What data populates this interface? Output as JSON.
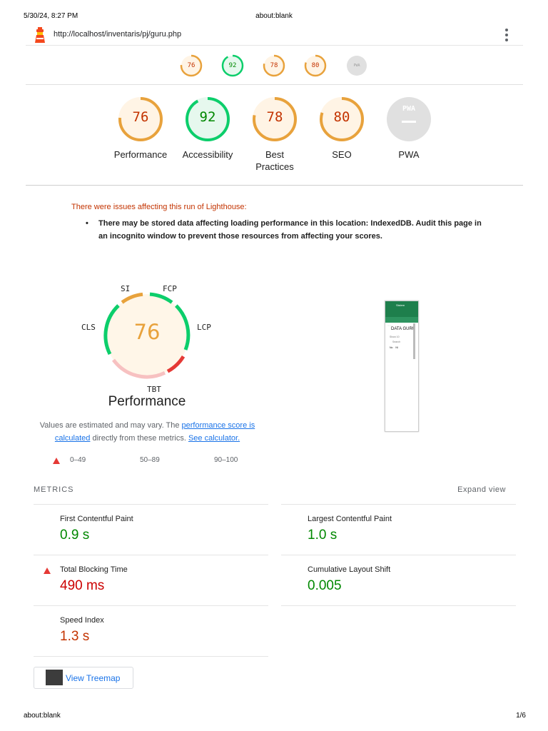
{
  "print_header": {
    "date": "5/30/24, 8:27 PM",
    "title": "about:blank"
  },
  "print_footer": {
    "left": "about:blank",
    "right": "1/6"
  },
  "topbar": {
    "url": "http://localhost/inventaris/pj/guru.php",
    "logo_icon": "lighthouse-icon",
    "menu_icon": "kebab-menu-icon"
  },
  "mini_scores": [
    {
      "label": "76",
      "color": "#e8a23c",
      "fraction": 0.76
    },
    {
      "label": "92",
      "color": "#0cce6b",
      "fraction": 0.92
    },
    {
      "label": "78",
      "color": "#e8a23c",
      "fraction": 0.78
    },
    {
      "label": "80",
      "color": "#e8a23c",
      "fraction": 0.8
    },
    {
      "label": "PWA",
      "color": "#9e9e9e",
      "fraction": 0
    }
  ],
  "categories": [
    {
      "score": "76",
      "label": "Performance",
      "color": "#e8a23c",
      "text_color": "#c33300",
      "bg": "#fff4e5",
      "fraction": 0.76
    },
    {
      "score": "92",
      "label": "Accessibility",
      "color": "#0cce6b",
      "text_color": "#008800",
      "bg": "#e6f8ee",
      "fraction": 0.92
    },
    {
      "score": "78",
      "label": "Best Practices",
      "color": "#e8a23c",
      "text_color": "#c33300",
      "bg": "#fff4e5",
      "fraction": 0.78
    },
    {
      "score": "80",
      "label": "SEO",
      "color": "#e8a23c",
      "text_color": "#c33300",
      "bg": "#fff4e5",
      "fraction": 0.8
    },
    {
      "score": "PWA",
      "label": "PWA",
      "color": "#9e9e9e",
      "text_color": "#ffffff",
      "bg": "#e0e0e0",
      "fraction": 0
    }
  ],
  "warnings": {
    "title": "There were issues affecting this run of Lighthouse:",
    "items": [
      "There may be stored data affecting loading performance in this location: IndexedDB. Audit this page in an incognito window to prevent those resources from affecting your scores."
    ]
  },
  "performance": {
    "score": "76",
    "title": "Performance",
    "gauge_labels": {
      "si": "SI",
      "fcp": "FCP",
      "lcp": "LCP",
      "tbt": "TBT",
      "cls": "CLS"
    },
    "desc_prefix": "Values are estimated and may vary. The ",
    "desc_link1": "performance score is calculated",
    "desc_middle": " directly from these metrics. ",
    "desc_link2": "See calculator."
  },
  "legend": {
    "fail": "0–49",
    "average": "50–89",
    "pass": "90–100"
  },
  "thumbnail": {
    "header": "Sistem",
    "subnav": "Guru",
    "title": "DATA GURU",
    "show": "Show 10",
    "search": "Search",
    "col1": "No",
    "col2": "NI"
  },
  "metrics": {
    "heading": "METRICS",
    "expand_label": "Expand view",
    "left": [
      {
        "name": "First Contentful Paint",
        "value": "0.9 s",
        "color": "#008800",
        "warn": false
      },
      {
        "name": "Total Blocking Time",
        "value": "490 ms",
        "color": "#cc0000",
        "warn": true
      },
      {
        "name": "Speed Index",
        "value": "1.3 s",
        "color": "#c33300",
        "warn": false
      }
    ],
    "right": [
      {
        "name": "Largest Contentful Paint",
        "value": "1.0 s",
        "color": "#008800",
        "warn": false
      },
      {
        "name": "Cumulative Layout Shift",
        "value": "0.005",
        "color": "#008800",
        "warn": false
      }
    ]
  },
  "treemap": {
    "label": "View Treemap"
  }
}
